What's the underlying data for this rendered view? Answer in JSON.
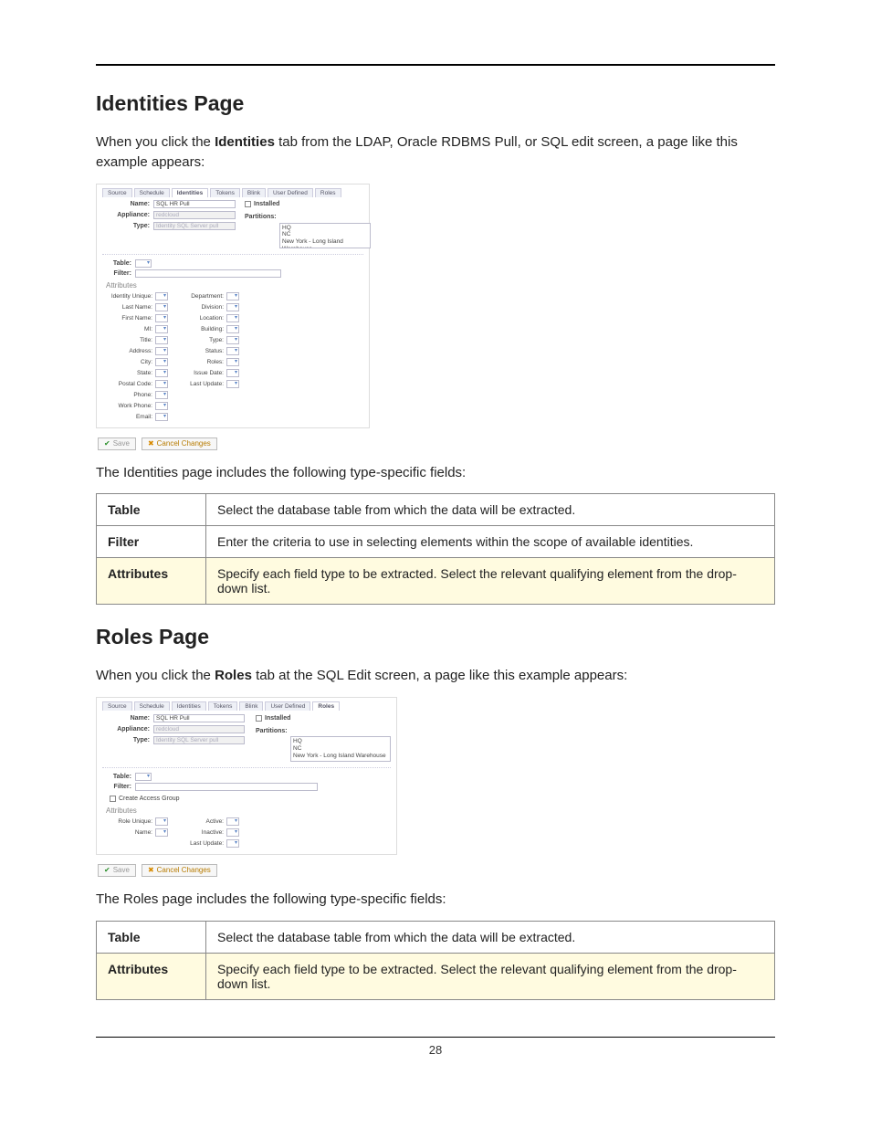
{
  "page_number": "28",
  "section1": {
    "title": "Identities Page",
    "intro_pre": "When you click the ",
    "intro_bold": "Identities",
    "intro_post": " tab  from the LDAP, Oracle RDBMS Pull, or SQL edit screen, a page like this example appears:",
    "after_img": "The Identities page includes the following type-specific fields:",
    "table": [
      {
        "term": "Table",
        "def": "Select the database table from which the data will be extracted."
      },
      {
        "term": "Filter",
        "def": "Enter the criteria to use in selecting elements within the scope of available identities."
      },
      {
        "term": "Attributes",
        "def": "Specify each field type to be extracted. Select the relevant qualifying element from the drop-down list."
      }
    ]
  },
  "section2": {
    "title": "Roles Page",
    "intro_pre": "When you click the ",
    "intro_bold": "Roles",
    "intro_post": " tab at the SQL Edit screen, a page like this example appears:",
    "after_img": "The Roles page includes the following type-specific fields:",
    "table": [
      {
        "term": "Table",
        "def": "Select the database table from which the data will be extracted."
      },
      {
        "term": "Attributes",
        "def": "Specify each field type to be extracted. Select the relevant qualifying element from the drop-down list."
      }
    ]
  },
  "shot1": {
    "tabs": [
      "Source",
      "Schedule",
      "Identities",
      "Tokens",
      "Blink",
      "User Defined",
      "Roles"
    ],
    "active_tab": "Identities",
    "form": {
      "name_lbl": "Name:",
      "name_val": "SQL HR Pull",
      "appliance_lbl": "Appliance:",
      "appliance_val": "redcloud",
      "type_lbl": "Type:",
      "type_val": "Identity SQL Server pull",
      "installed_lbl": "Installed",
      "partitions_lbl": "Partitions:",
      "partitions": [
        "HQ",
        "NC",
        "New York - Long Island Warehouse"
      ],
      "table_lbl": "Table:",
      "filter_lbl": "Filter:",
      "attr_hdr": "Attributes"
    },
    "attrs_left": [
      "Identity Unique:",
      "Last Name:",
      "First Name:",
      "MI:",
      "Title:",
      "Address:",
      "City:",
      "State:",
      "Postal Code:",
      "Phone:",
      "Work Phone:",
      "Email:"
    ],
    "attrs_right": [
      "Department:",
      "Division:",
      "Location:",
      "Building:",
      "Type:",
      "Status:",
      "Roles:",
      "Issue Date:",
      "Last Update:"
    ],
    "save_btn": "Save",
    "cancel_btn": "Cancel Changes"
  },
  "shot2": {
    "tabs": [
      "Source",
      "Schedule",
      "Identities",
      "Tokens",
      "Blink",
      "User Defined",
      "Roles"
    ],
    "active_tab": "Roles",
    "form": {
      "name_lbl": "Name:",
      "name_val": "SQL HR Pull",
      "appliance_lbl": "Appliance:",
      "appliance_val": "redcloud",
      "type_lbl": "Type:",
      "type_val": "Identity SQL Server pull",
      "installed_lbl": "Installed",
      "partitions_lbl": "Partitions:",
      "partitions": [
        "HQ",
        "NC",
        "New York - Long Island Warehouse"
      ],
      "table_lbl": "Table:",
      "filter_lbl": "Filter:",
      "cag_lbl": "Create Access Group",
      "attr_hdr": "Attributes"
    },
    "attrs_left": [
      "Role Unique:",
      "Name:"
    ],
    "attrs_right": [
      "Active:",
      "Inactive:",
      "Last Update:"
    ],
    "save_btn": "Save",
    "cancel_btn": "Cancel Changes"
  }
}
